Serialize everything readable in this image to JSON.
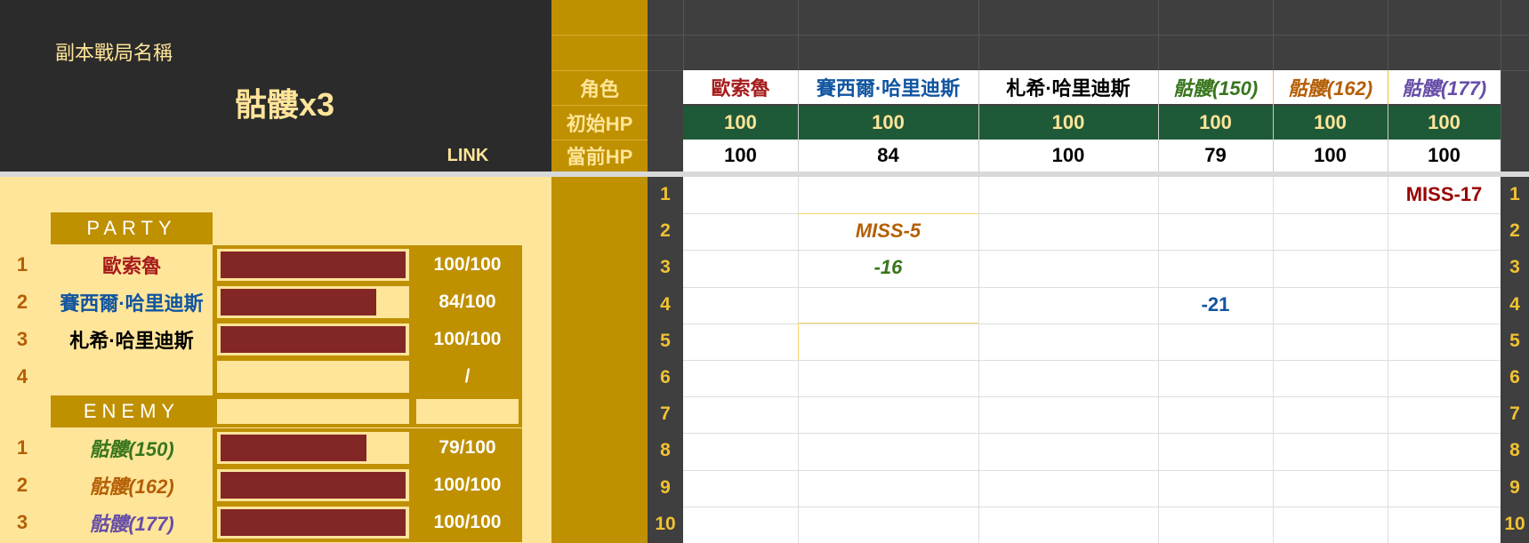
{
  "header": {
    "instance_label": "副本戰局名稱",
    "instance_name": "骷髏x3",
    "link_label": "LINK",
    "row_labels": {
      "role": "角色",
      "initial_hp": "初始HP",
      "current_hp": "當前HP"
    }
  },
  "characters": [
    {
      "name": "歐索魯",
      "initial_hp": "100",
      "current_hp": "100",
      "color": "#a61c1c",
      "italic": false
    },
    {
      "name": "賽西爾·哈里迪斯",
      "initial_hp": "100",
      "current_hp": "84",
      "color": "#1155a0",
      "italic": false
    },
    {
      "name": "札希·哈里迪斯",
      "initial_hp": "100",
      "current_hp": "100",
      "color": "#000000",
      "italic": false
    },
    {
      "name": "骷髏(150)",
      "initial_hp": "100",
      "current_hp": "79",
      "color": "#38761d",
      "italic": true
    },
    {
      "name": "骷髏(162)",
      "initial_hp": "100",
      "current_hp": "100",
      "color": "#b45f06",
      "italic": true
    },
    {
      "name": "骷髏(177)",
      "initial_hp": "100",
      "current_hp": "100",
      "color": "#674ea7",
      "italic": true
    }
  ],
  "party": {
    "title": "PARTY",
    "members": [
      {
        "index": "1",
        "name": "歐索魯",
        "hp_text": "100/100",
        "hp_fraction": 1.0,
        "color": "#a61c1c",
        "italic": false
      },
      {
        "index": "2",
        "name": "賽西爾·哈里迪斯",
        "hp_text": "84/100",
        "hp_fraction": 0.84,
        "color": "#1155a0",
        "italic": false
      },
      {
        "index": "3",
        "name": "札希·哈里迪斯",
        "hp_text": "100/100",
        "hp_fraction": 1.0,
        "color": "#000000",
        "italic": false
      },
      {
        "index": "4",
        "name": "",
        "hp_text": "/",
        "hp_fraction": 0,
        "color": "#000000",
        "italic": false
      }
    ]
  },
  "enemy": {
    "title": "ENEMY",
    "members": [
      {
        "index": "1",
        "name": "骷髏(150)",
        "hp_text": "79/100",
        "hp_fraction": 0.79,
        "color": "#38761d",
        "italic": true
      },
      {
        "index": "2",
        "name": "骷髏(162)",
        "hp_text": "100/100",
        "hp_fraction": 1.0,
        "color": "#b45f06",
        "italic": true
      },
      {
        "index": "3",
        "name": "骷髏(177)",
        "hp_text": "100/100",
        "hp_fraction": 1.0,
        "color": "#674ea7",
        "italic": true
      }
    ]
  },
  "turns": {
    "row_numbers": [
      "1",
      "2",
      "3",
      "4",
      "5",
      "6",
      "7",
      "8",
      "9",
      "10"
    ],
    "entries": [
      {
        "row": 1,
        "col": 5,
        "text": "MISS-17",
        "color": "#990000",
        "italic": false
      },
      {
        "row": 2,
        "col": 1,
        "text": "MISS-5",
        "color": "#b45f06",
        "italic": true
      },
      {
        "row": 3,
        "col": 1,
        "text": "-16",
        "color": "#38761d",
        "italic": true
      },
      {
        "row": 4,
        "col": 3,
        "text": "-21",
        "color": "#1155a0",
        "italic": false
      }
    ]
  },
  "colors": {
    "gold": "#bf9000",
    "dark_header": "#2b2b2b",
    "cream": "#ffe599",
    "hp_bar": "#832626",
    "green_band": "#1f5a38",
    "header_text": "#ffe599",
    "row_number_text": "#f1c232"
  }
}
